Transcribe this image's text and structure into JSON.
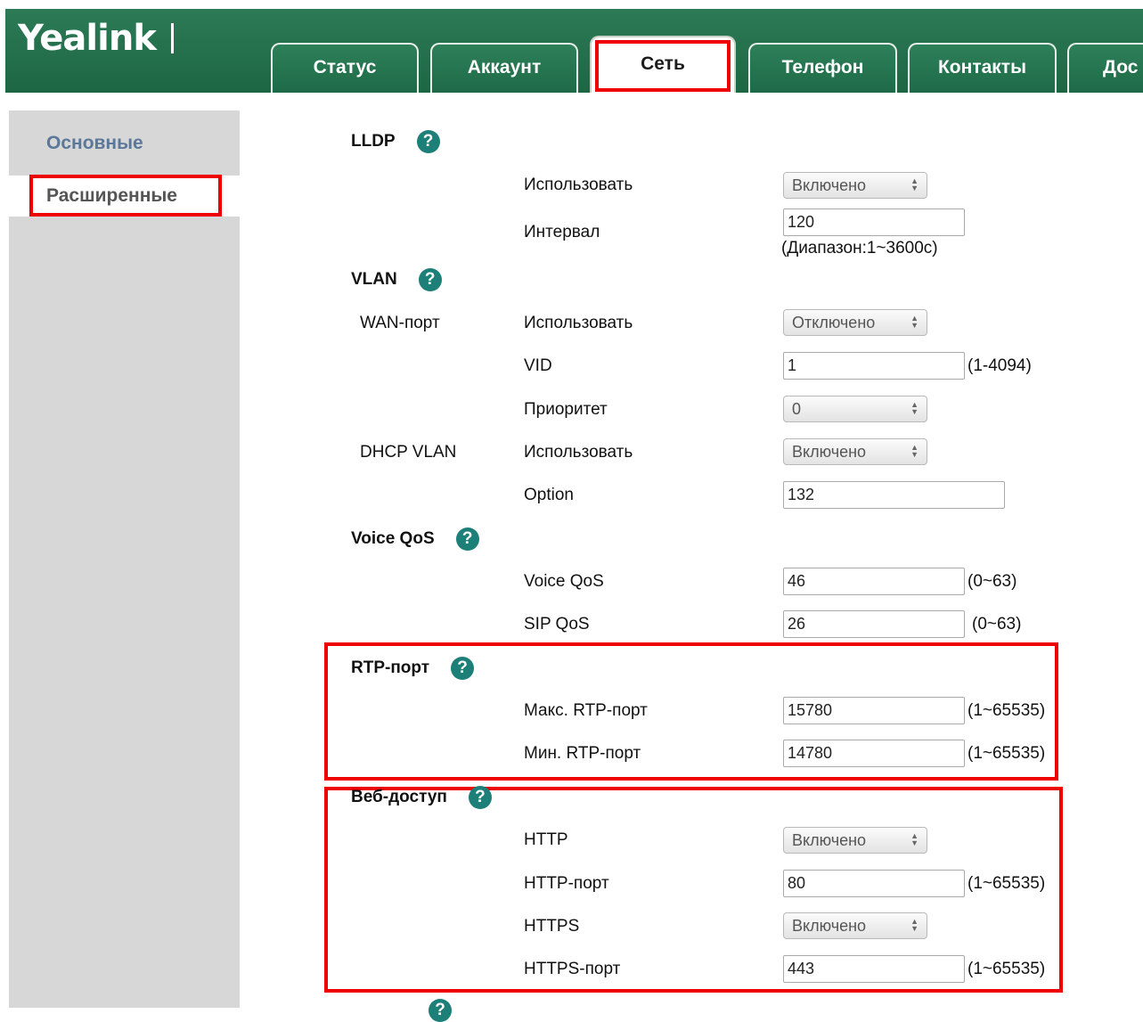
{
  "header": {
    "logo": "Yealink",
    "tabs": [
      {
        "label": "Статус"
      },
      {
        "label": "Аккаунт"
      },
      {
        "label": "Сеть"
      },
      {
        "label": "Телефон"
      },
      {
        "label": "Контакты"
      },
      {
        "label": "Дос"
      }
    ],
    "active_tab": "Сеть"
  },
  "sidebar": {
    "items": [
      {
        "label": "Основные"
      },
      {
        "label": "Расширенные"
      }
    ],
    "active_item": "Расширенные"
  },
  "sections": {
    "lldp": {
      "title": "LLDP",
      "enable_label": "Использовать",
      "enable_value": "Включено",
      "interval_label": "Интервал",
      "interval_value": "120",
      "interval_hint": "(Диапазон:1~3600с)"
    },
    "vlan": {
      "title": "VLAN",
      "wan_label": "WAN-порт",
      "wan_enable_label": "Использовать",
      "wan_enable_value": "Отключено",
      "vid_label": "VID",
      "vid_value": "1",
      "vid_hint": "(1-4094)",
      "priority_label": "Приоритет",
      "priority_value": "0",
      "dhcp_label": "DHCP VLAN",
      "dhcp_enable_label": "Использовать",
      "dhcp_enable_value": "Включено",
      "option_label": "Option",
      "option_value": "132"
    },
    "voice_qos": {
      "title": "Voice QoS",
      "voice_label": "Voice QoS",
      "voice_value": "46",
      "voice_hint": "(0~63)",
      "sip_label": "SIP QoS",
      "sip_value": "26",
      "sip_hint": "(0~63)"
    },
    "rtp": {
      "title": "RTP-порт",
      "max_label": "Макс. RTP-порт",
      "max_value": "15780",
      "max_hint": "(1~65535)",
      "min_label": "Мин. RTP-порт",
      "min_value": "14780",
      "min_hint": "(1~65535)"
    },
    "web": {
      "title": "Веб-доступ",
      "http_label": "HTTP",
      "http_value": "Включено",
      "http_port_label": "HTTP-порт",
      "http_port_value": "80",
      "http_port_hint": "(1~65535)",
      "https_label": "HTTPS",
      "https_value": "Включено",
      "https_port_label": "HTTPS-порт",
      "https_port_value": "443",
      "https_port_hint": "(1~65535)"
    }
  },
  "help_glyph": "?",
  "colors": {
    "header_green": "#1d6644",
    "highlight_red": "#ee0000",
    "help_teal": "#1c7f78",
    "sidebar_gray": "#d7d7d7"
  }
}
